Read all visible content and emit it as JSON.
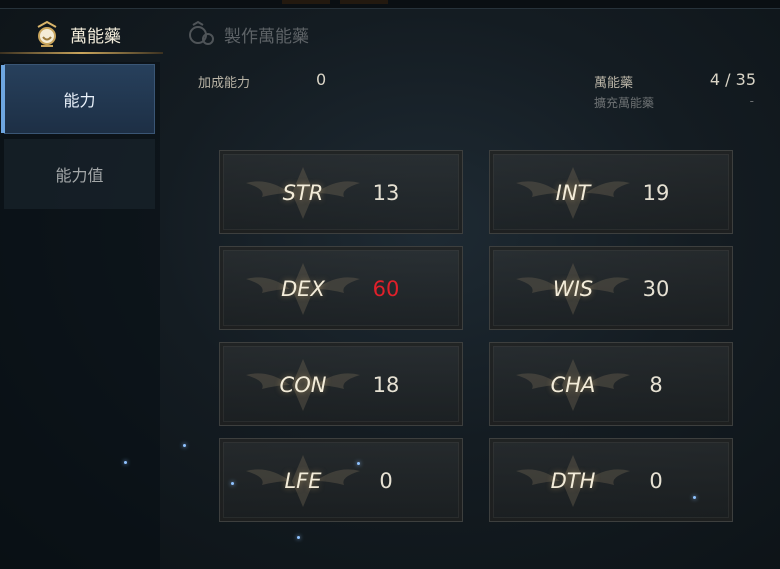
{
  "tabs": [
    {
      "label": "萬能藥",
      "icon": "potion-icon",
      "active": true
    },
    {
      "label": "製作萬能藥",
      "icon": "craft-potion-icon",
      "active": false
    }
  ],
  "sidebar": {
    "items": [
      {
        "label": "能力",
        "active": true
      },
      {
        "label": "能力值",
        "active": false
      }
    ]
  },
  "info": {
    "bonus_label": "加成能力",
    "bonus_value": "0",
    "potion_label": "萬能藥",
    "potion_value": "4 / 35",
    "expand_label": "擴充萬能藥",
    "expand_value": "-"
  },
  "stats": [
    {
      "name": "STR",
      "value": "13"
    },
    {
      "name": "INT",
      "value": "19"
    },
    {
      "name": "DEX",
      "value": "60",
      "highlight": true
    },
    {
      "name": "WIS",
      "value": "30"
    },
    {
      "name": "CON",
      "value": "18"
    },
    {
      "name": "CHA",
      "value": "8"
    },
    {
      "name": "LFE",
      "value": "0"
    },
    {
      "name": "DTH",
      "value": "0"
    }
  ],
  "colors": {
    "accent_gold": "#c9a55c",
    "highlight_red": "#e0202a",
    "active_tab_blue": "#27405c"
  }
}
